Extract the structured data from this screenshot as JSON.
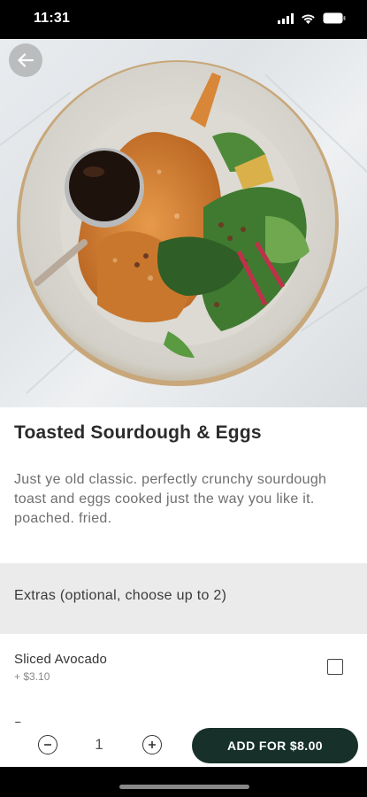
{
  "status_bar": {
    "time": "11:31",
    "icons": [
      "signal-icon",
      "wifi-icon",
      "battery-icon"
    ]
  },
  "hero": {
    "image_subject": "plate-of-food-photo",
    "back_icon": "arrow-left-icon"
  },
  "item": {
    "title": "Toasted Sourdough & Eggs",
    "description": "Just ye old classic. perfectly crunchy sourdough toast and eggs cooked just the way you like it. poached. fried."
  },
  "extras": {
    "header": "Extras (optional, choose up to 2)",
    "options": [
      {
        "name": "Sliced Avocado",
        "price": "+ $3.10",
        "checked": false
      },
      {
        "name": "Bacon",
        "price": "",
        "checked": false
      }
    ]
  },
  "order": {
    "quantity": "1",
    "add_label": "ADD FOR $8.00",
    "accent": "#17312a"
  }
}
